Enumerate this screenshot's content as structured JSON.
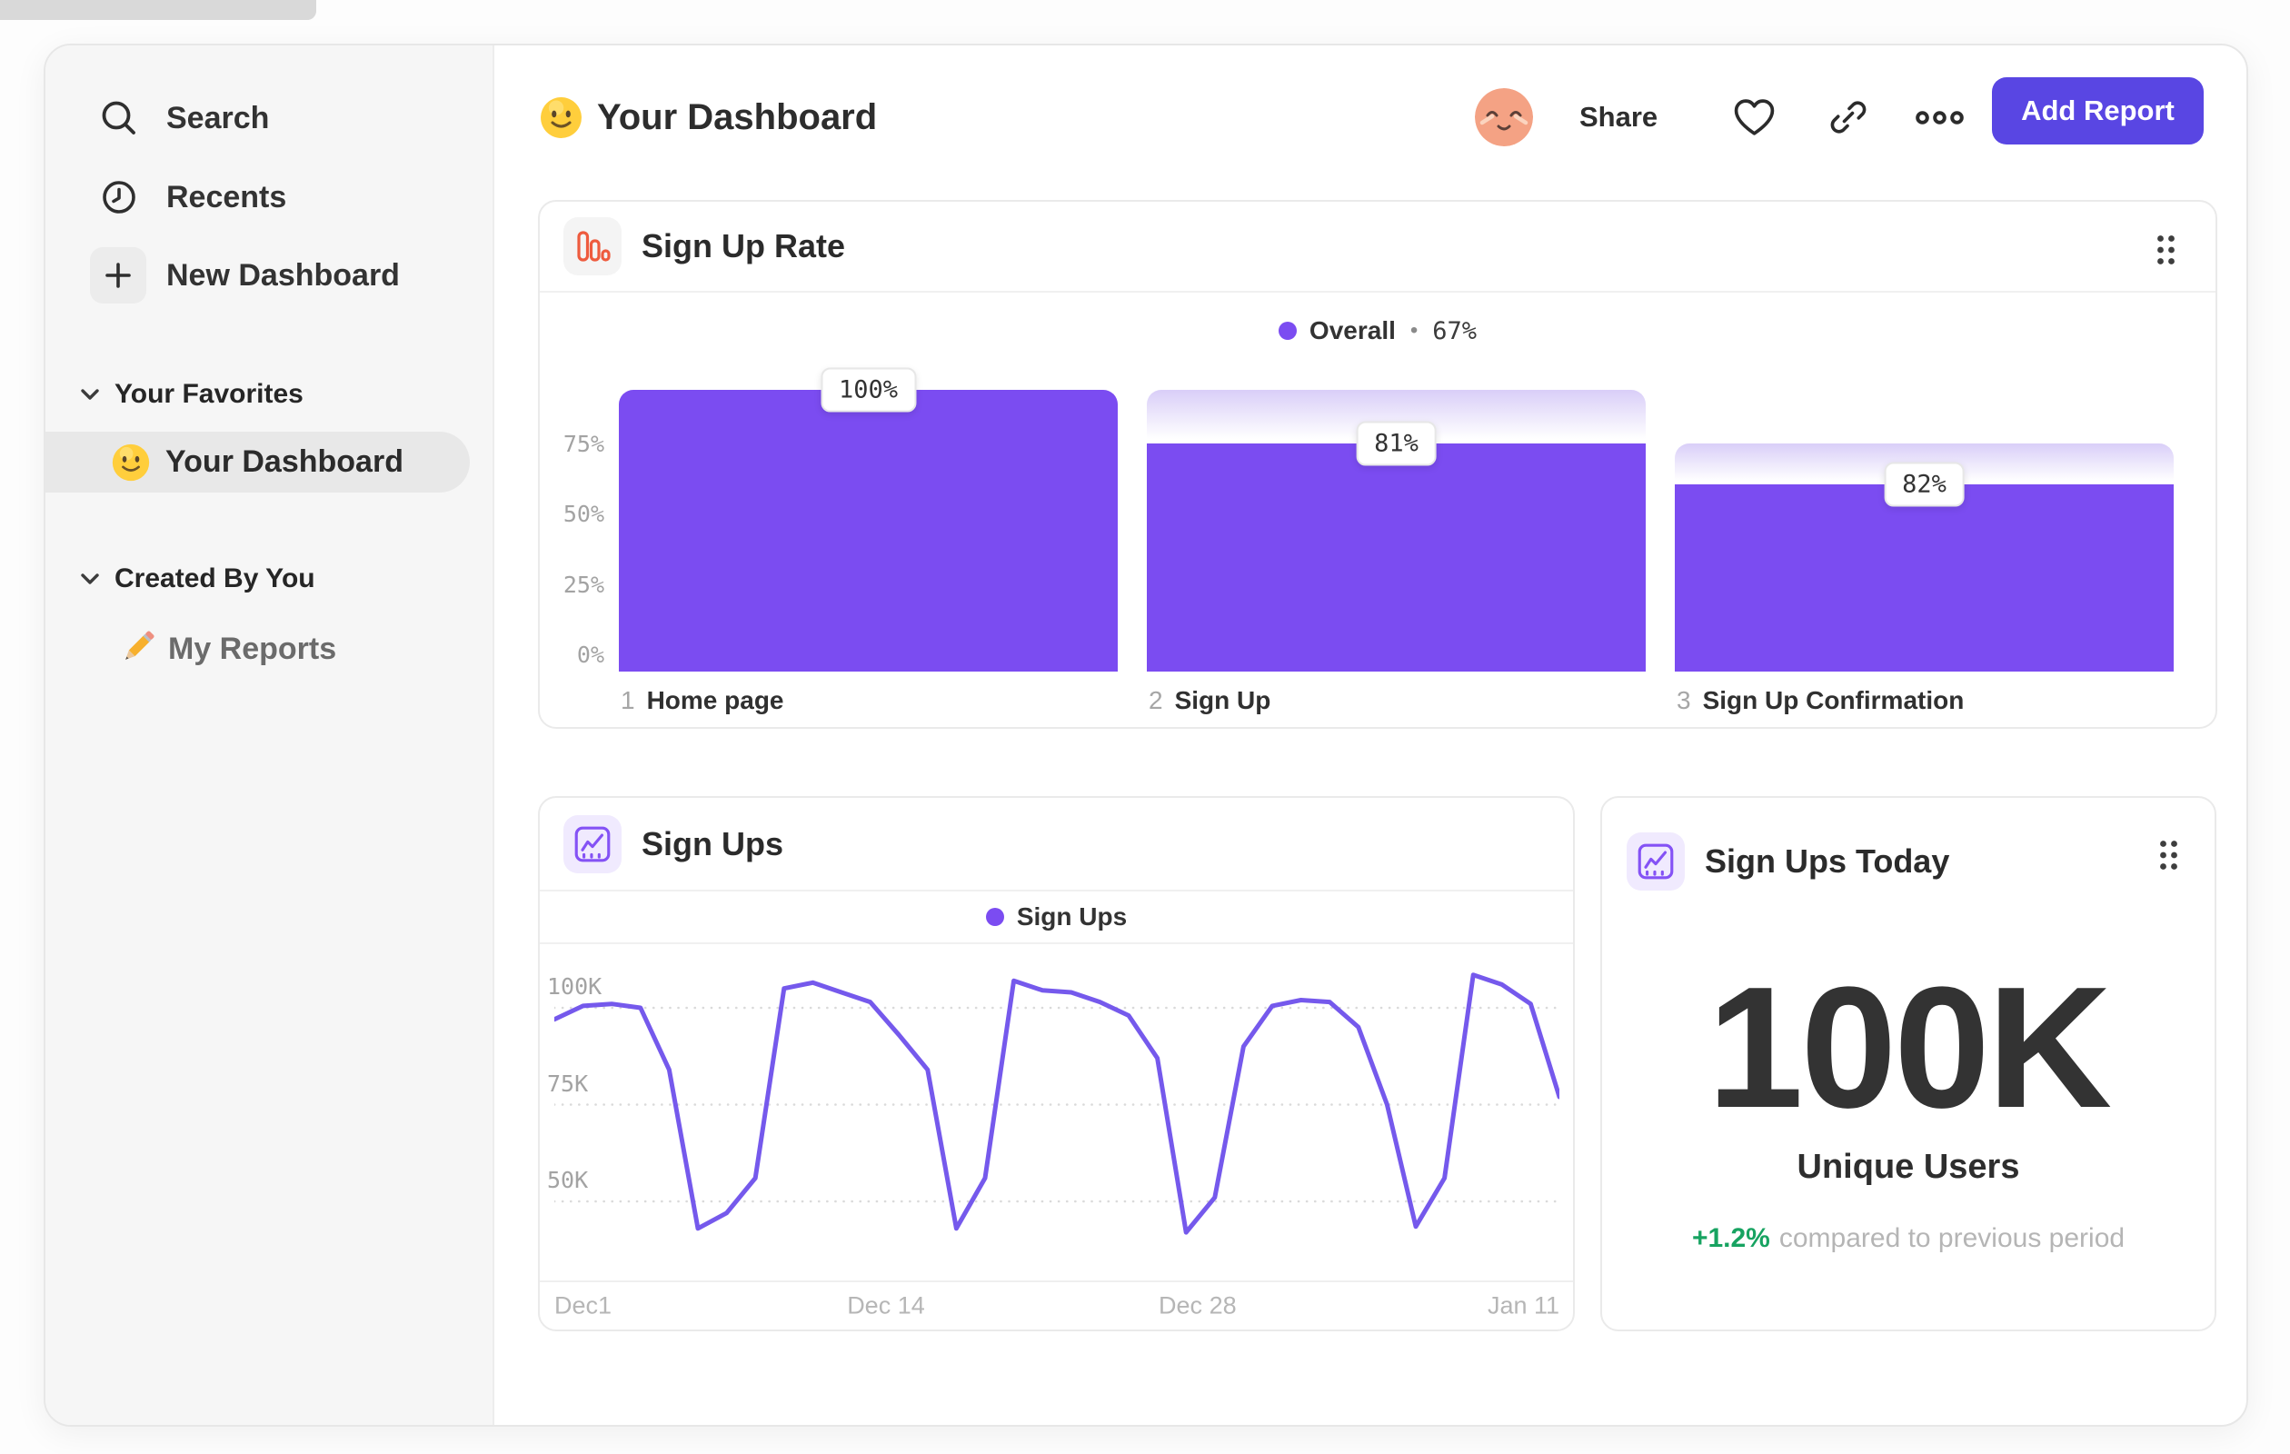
{
  "sidebar": {
    "items": [
      {
        "label": "Search",
        "icon": "search-icon"
      },
      {
        "label": "Recents",
        "icon": "clock-icon"
      },
      {
        "label": "New Dashboard",
        "icon": "plus-icon"
      }
    ],
    "sections": [
      {
        "header": "Your Favorites",
        "items": [
          {
            "label": "Your Dashboard",
            "icon": "smiley-emoji",
            "selected": true
          }
        ]
      },
      {
        "header": "Created By You",
        "items": [
          {
            "label": "My Reports",
            "icon": "pencil-emoji",
            "selected": false
          }
        ]
      }
    ]
  },
  "header": {
    "title": "Your Dashboard",
    "share_label": "Share",
    "add_report_label": "Add Report"
  },
  "funnel_card": {
    "title": "Sign Up Rate",
    "legend_name": "Overall",
    "legend_sep": "•",
    "legend_value": "67%"
  },
  "line_card": {
    "title": "Sign Ups",
    "legend_name": "Sign Ups"
  },
  "kpi_card": {
    "title": "Sign Ups Today",
    "value": "100K",
    "label": "Unique Users",
    "delta": "+1.2%",
    "delta_note": "compared to previous period"
  },
  "colors": {
    "purple": "#7B4CF1",
    "line_purple": "#7559EC",
    "button_purple": "#5946E3",
    "green": "#17A361",
    "coral": "#EE5B3E",
    "icon_purple": "#8452F5",
    "grid": "#DADADA"
  },
  "chart_data": [
    {
      "type": "bar",
      "subtype": "funnel",
      "title": "Sign Up Rate",
      "legend": {
        "series": "Overall",
        "overall_conversion": "67%"
      },
      "ylim": [
        0,
        100
      ],
      "yticks": [
        {
          "label": "75%",
          "value": 75
        },
        {
          "label": "50%",
          "value": 50
        },
        {
          "label": "25%",
          "value": 25
        },
        {
          "label": "0%",
          "value": 0
        }
      ],
      "steps": [
        {
          "index": "1",
          "name": "Home page",
          "label": "100%",
          "step_conversion": 100,
          "overall": 100
        },
        {
          "index": "2",
          "name": "Sign Up",
          "label": "81%",
          "step_conversion": 81,
          "overall": 81
        },
        {
          "index": "3",
          "name": "Sign Up Confirmation",
          "label": "82%",
          "step_conversion": 82,
          "overall": 66.4
        }
      ]
    },
    {
      "type": "line",
      "title": "Sign Ups",
      "legend": [
        "Sign Ups"
      ],
      "unit": "thousands",
      "ylim": [
        29,
        114
      ],
      "yticks": [
        {
          "label": "100K",
          "value": 100
        },
        {
          "label": "75K",
          "value": 75
        },
        {
          "label": "50K",
          "value": 50
        }
      ],
      "xticks": [
        {
          "label": "Dec1",
          "pos": 0,
          "align": "left"
        },
        {
          "label": "Dec 14",
          "pos": 0.33,
          "align": "center"
        },
        {
          "label": "Dec 28",
          "pos": 0.64,
          "align": "center"
        },
        {
          "label": "Jan 11",
          "pos": 1,
          "align": "right"
        }
      ],
      "values": [
        97,
        100.5,
        101,
        100,
        84,
        43,
        47,
        56,
        105,
        106.5,
        104,
        101.5,
        93,
        84,
        43,
        56,
        107,
        104.5,
        104,
        101.5,
        98,
        87,
        42,
        51,
        90,
        100.5,
        102,
        101.5,
        95,
        75,
        43.5,
        56,
        108.5,
        106,
        101,
        77
      ]
    }
  ]
}
